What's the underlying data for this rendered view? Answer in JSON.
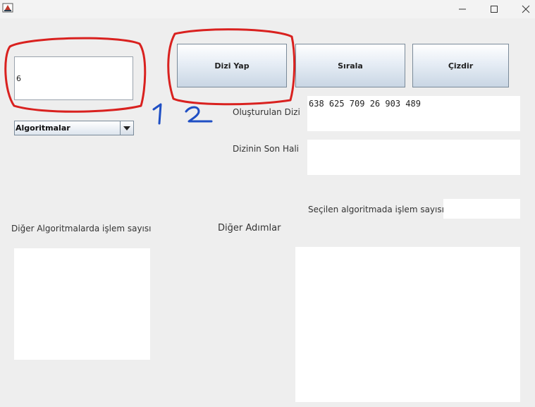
{
  "window": {
    "icon": "java-app-icon",
    "controls": [
      "minimize-icon",
      "maximize-icon",
      "close-icon"
    ]
  },
  "input": {
    "value": "6"
  },
  "buttons": {
    "make_array": "Dizi Yap",
    "sort": "Sırala",
    "draw": "Çizdir"
  },
  "algorithm_select": {
    "selected": "Algoritmalar"
  },
  "labels": {
    "created_array": "Oluşturulan Dizi",
    "final_array": "Dizinin Son Hali",
    "selected_algo_ops": "Seçilen algoritmada işlem sayısı",
    "other_algo_ops": "Diğer Algoritmalarda işlem sayısı",
    "other_steps": "Diğer Adımlar"
  },
  "values": {
    "created_array": "638 625 709 26 903 489",
    "final_array": "",
    "selected_algo_ops": "",
    "other_algo_ops": "",
    "other_steps": ""
  },
  "annotations": {
    "marker_1": "1",
    "marker_2": "2",
    "circle_color": "#d9211f",
    "number_color": "#1f4fc4"
  }
}
